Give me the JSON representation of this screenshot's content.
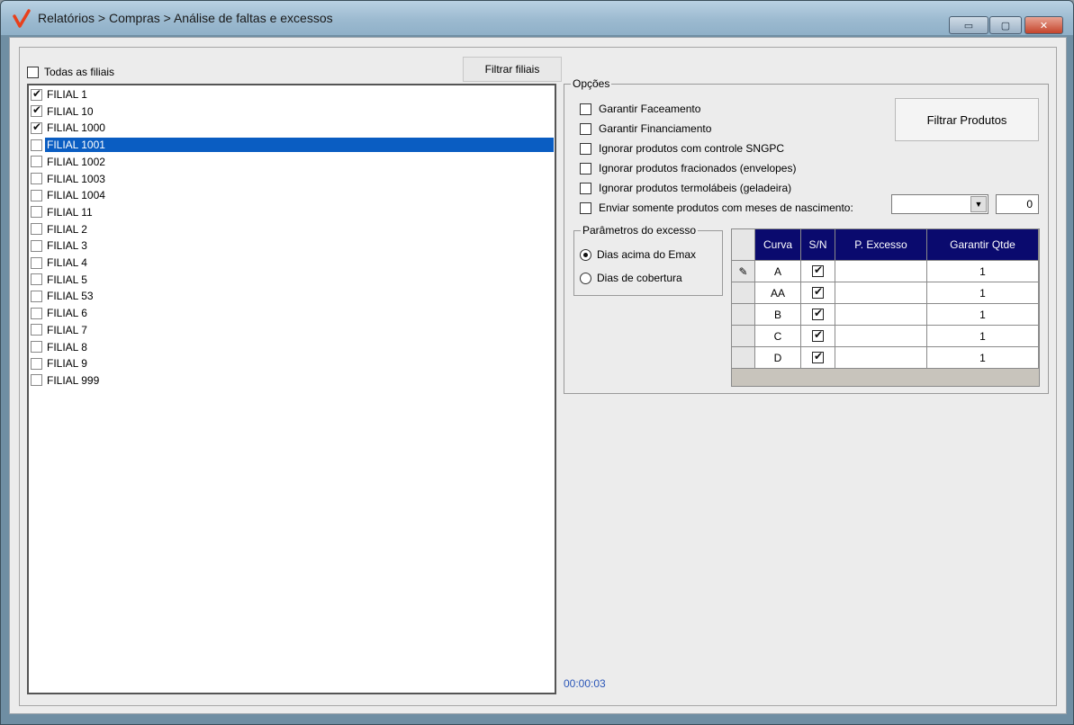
{
  "window": {
    "title": "Relatórios > Compras > Análise de faltas e excessos",
    "controls": {
      "minimize": "▭",
      "maximize": "▢",
      "close": "✕"
    }
  },
  "filiais": {
    "todas_label": "Todas as filiais",
    "filtrar_label": "Filtrar filiais",
    "items": [
      {
        "label": "FILIAL 1",
        "checked": true
      },
      {
        "label": "FILIAL 10",
        "checked": true
      },
      {
        "label": "FILIAL 1000",
        "checked": true
      },
      {
        "label": "FILIAL 1001",
        "checked": false,
        "selected": true
      },
      {
        "label": "FILIAL 1002",
        "checked": false
      },
      {
        "label": "FILIAL 1003",
        "checked": false
      },
      {
        "label": "FILIAL 1004",
        "checked": false
      },
      {
        "label": "FILIAL 11",
        "checked": false
      },
      {
        "label": "FILIAL 2",
        "checked": false
      },
      {
        "label": "FILIAL 3",
        "checked": false
      },
      {
        "label": "FILIAL 4",
        "checked": false
      },
      {
        "label": "FILIAL 5",
        "checked": false
      },
      {
        "label": "FILIAL 53",
        "checked": false
      },
      {
        "label": "FILIAL 6",
        "checked": false
      },
      {
        "label": "FILIAL 7",
        "checked": false
      },
      {
        "label": "FILIAL 8",
        "checked": false
      },
      {
        "label": "FILIAL 9",
        "checked": false
      },
      {
        "label": "FILIAL 999",
        "checked": false
      }
    ]
  },
  "opcoes": {
    "label": "Opções",
    "checks": [
      {
        "label": "Garantir Faceamento",
        "checked": false
      },
      {
        "label": "Garantir Financiamento",
        "checked": false
      },
      {
        "label": "Ignorar produtos com controle SNGPC",
        "checked": false
      },
      {
        "label": "Ignorar produtos fracionados (envelopes)",
        "checked": false
      },
      {
        "label": "Ignorar produtos termolábeis (geladeira)",
        "checked": false
      },
      {
        "label": "Enviar somente produtos com meses de nascimento:",
        "checked": false
      }
    ],
    "filtrar_produtos_label": "Filtrar Produtos",
    "meses_combo_value": "",
    "meses_value": "0"
  },
  "parametros": {
    "label": "Parâmetros do excesso",
    "options": [
      {
        "label": "Dias acima do Emax",
        "selected": true
      },
      {
        "label": "Dias de cobertura",
        "selected": false
      }
    ]
  },
  "grid": {
    "headers": [
      "Curva",
      "S/N",
      "P. Excesso",
      "Garantir Qtde"
    ],
    "edit_icon": "✎",
    "rows": [
      {
        "curva": "A",
        "sn": true,
        "p_excesso": "",
        "garantir": "1"
      },
      {
        "curva": "AA",
        "sn": true,
        "p_excesso": "",
        "garantir": "1"
      },
      {
        "curva": "B",
        "sn": true,
        "p_excesso": "",
        "garantir": "1"
      },
      {
        "curva": "C",
        "sn": true,
        "p_excesso": "",
        "garantir": "1"
      },
      {
        "curva": "D",
        "sn": true,
        "p_excesso": "",
        "garantir": "1"
      }
    ]
  },
  "status": {
    "timer": "00:00:03"
  },
  "colors": {
    "accent": "#0a5dc2",
    "grid_header": "#0a0a6e",
    "timer": "#2a56b8"
  }
}
